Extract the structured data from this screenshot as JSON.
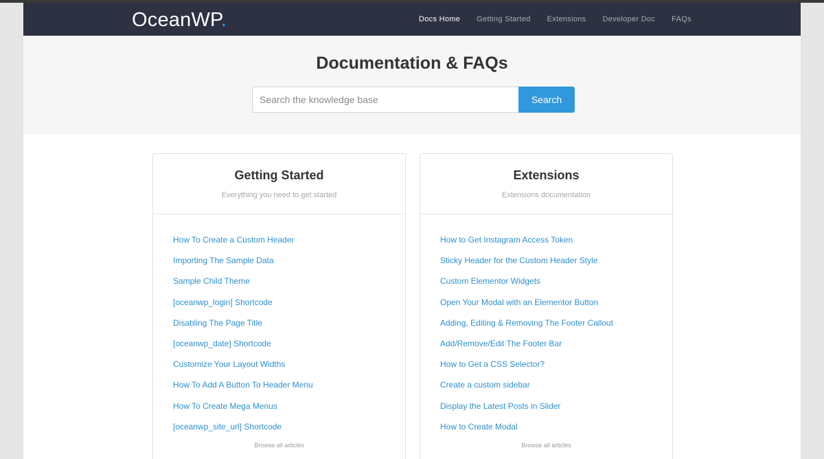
{
  "brand": {
    "name": "OceanWP",
    "dot": ".",
    "dot_color": "#13aff0"
  },
  "nav": {
    "items": [
      {
        "label": "Docs Home",
        "active": true
      },
      {
        "label": "Getting Started"
      },
      {
        "label": "Extensions"
      },
      {
        "label": "Developer Doc"
      },
      {
        "label": "FAQs"
      }
    ]
  },
  "hero": {
    "title": "Documentation & FAQs",
    "search_placeholder": "Search the knowledge base",
    "search_value": "",
    "search_button": "Search"
  },
  "cards": [
    {
      "title": "Getting Started",
      "subtitle": "Everything you need to get started",
      "items": [
        "How To Create a Custom Header",
        "Importing The Sample Data",
        "Sample Child Theme",
        "[oceanwp_login] Shortcode",
        "Disabling The Page Title",
        "[oceanwp_date] Shortcode",
        "Customize Your Layout Widths",
        "How To Add A Button To Header Menu",
        "How To Create Mega Menus",
        "[oceanwp_site_url] Shortcode"
      ],
      "browse": "Browse all articles"
    },
    {
      "title": "Extensions",
      "subtitle": "Extensions documentation",
      "items": [
        "How to Get Instagram Access Token",
        "Sticky Header for the Custom Header Style",
        "Custom Elementor Widgets",
        "Open Your Modal with an Elementor Button",
        "Adding, Editing & Removing The Footer Callout",
        "Add/Remove/Edit The Footer Bar",
        "How to Get a CSS Selector?",
        "Create a custom sidebar",
        "Display the Latest Posts in Slider",
        "How to Create Modal"
      ],
      "browse": "Browse all articles"
    }
  ],
  "colors": {
    "nav_bg": "#2d3142",
    "link": "#2f8fd0",
    "button": "#3198dd"
  }
}
